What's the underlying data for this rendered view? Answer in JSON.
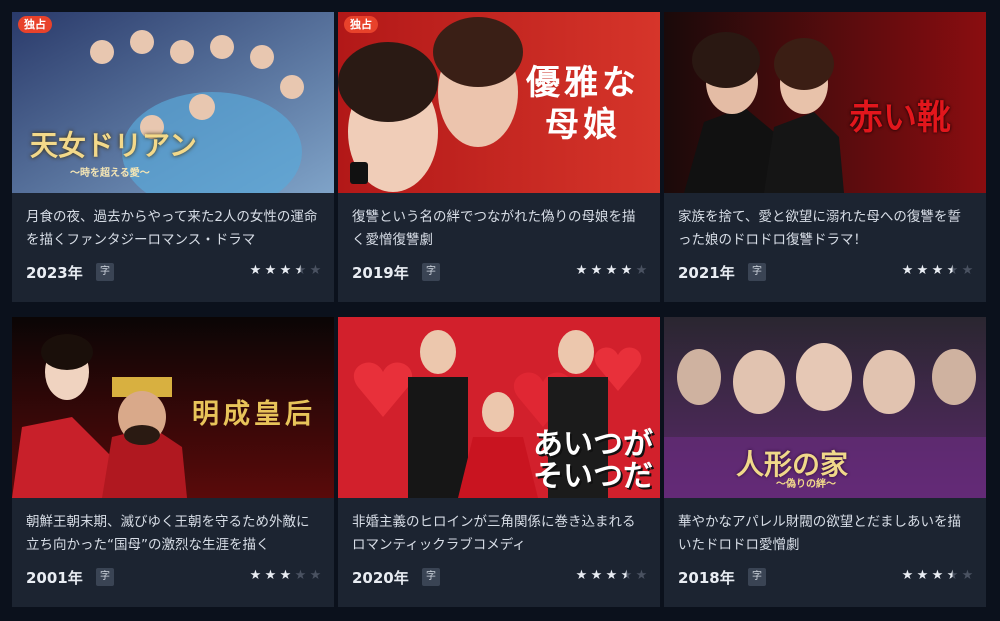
{
  "cards": [
    {
      "badge": "独占",
      "overlay": "天女ドリアン",
      "overlay_sub": "〜時を超える愛〜",
      "description": "月食の夜、過去からやって来た2人の女性の運命を描くファンタジーロマンス・ドラマ",
      "year": "2023年",
      "subtitle_mark": "字",
      "rating": 3.5
    },
    {
      "badge": "独占",
      "overlay": "優雅な母娘",
      "overlay_sub": "",
      "description": "復讐という名の絆でつながれた偽りの母娘を描く愛憎復讐劇",
      "year": "2019年",
      "subtitle_mark": "字",
      "rating": 4
    },
    {
      "badge": "",
      "overlay": "赤い靴",
      "overlay_sub": "",
      "description": "家族を捨て、愛と欲望に溺れた母への復讐を誓った娘のドロドロ復讐ドラマ！",
      "year": "2021年",
      "subtitle_mark": "字",
      "rating": 3.5
    },
    {
      "badge": "",
      "overlay": "明成皇后",
      "overlay_sub": "",
      "description": "朝鮮王朝末期、滅びゆく王朝を守るため外敵に立ち向かった“国母”の激烈な生涯を描く",
      "year": "2001年",
      "subtitle_mark": "字",
      "rating": 3
    },
    {
      "badge": "",
      "overlay": "あいつがそいつだ",
      "overlay_sub": "",
      "description": "非婚主義のヒロインが三角関係に巻き込まれるロマンティックラブコメディ",
      "year": "2020年",
      "subtitle_mark": "字",
      "rating": 3.5
    },
    {
      "badge": "",
      "overlay": "人形の家",
      "overlay_sub": "〜偽りの絆〜",
      "description": "華やかなアパレル財閥の欲望とだましあいを描いたドロドロ愛憎劇",
      "year": "2018年",
      "subtitle_mark": "字",
      "rating": 3.5
    }
  ],
  "colors": {
    "background": "#0b111c",
    "card": "#1c2431",
    "badge": "#e8422b",
    "star_on": "#e9edf3",
    "star_off": "#4a5261"
  },
  "icons": {
    "star": "star-icon",
    "subtitle": "subtitle-badge"
  }
}
